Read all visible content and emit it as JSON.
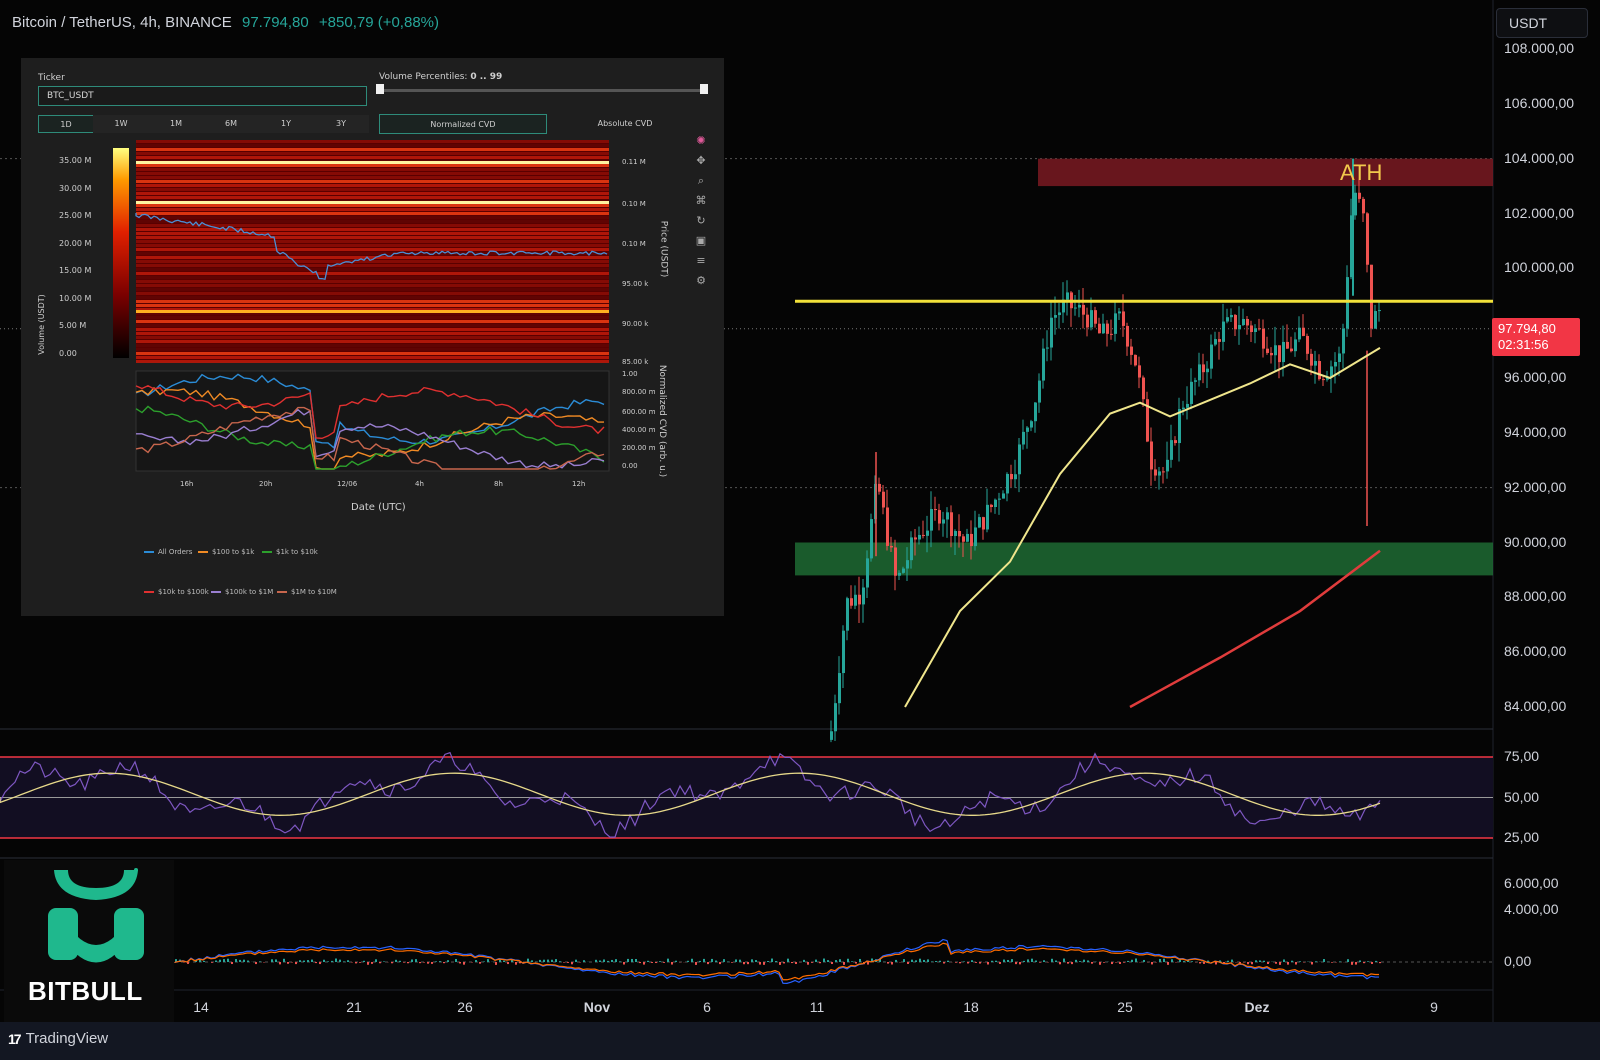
{
  "header": {
    "symbol": "Bitcoin / TetherUS, 4h, BINANCE",
    "last_price": "97.794,80",
    "change": "+850,79 (+0,88%)"
  },
  "currency_button": "USDT",
  "price_axis": [
    "108.000,00",
    "106.000,00",
    "104.000,00",
    "102.000,00",
    "100.000,00",
    "96.000,00",
    "94.000,00",
    "92.000,00",
    "90.000,00",
    "88.000,00",
    "86.000,00",
    "84.000,00"
  ],
  "last_price_tag": {
    "price": "97.794,80",
    "countdown": "02:31:56"
  },
  "ath_label": "ATH",
  "rsi_axis": [
    "75,00",
    "50,00",
    "25,00"
  ],
  "macd_axis": [
    "6.000,00",
    "4.000,00",
    "0,00"
  ],
  "date_axis": [
    {
      "label": "14",
      "bold": false
    },
    {
      "label": "21",
      "bold": false
    },
    {
      "label": "26",
      "bold": false
    },
    {
      "label": "Nov",
      "bold": true
    },
    {
      "label": "6",
      "bold": false
    },
    {
      "label": "11",
      "bold": false
    },
    {
      "label": "18",
      "bold": false
    },
    {
      "label": "25",
      "bold": false
    },
    {
      "label": "Dez",
      "bold": true
    },
    {
      "label": "9",
      "bold": false
    }
  ],
  "footer": {
    "brand": "TradingView",
    "mark": "17"
  },
  "bitbull": {
    "name": "BITBULL",
    "brand_color": "#1fb88d"
  },
  "colors": {
    "up": "#26a69a",
    "down": "#ef5350",
    "ath_zone": "#7a1a22",
    "support_zone": "#1f6b34",
    "resistance_line": "#f2e13a",
    "ma_fast": "#f0e68c",
    "ma_slow": "#e03c3c",
    "rsi_line": "#7e57c2"
  },
  "cvd": {
    "ticker_label": "Ticker",
    "ticker_value": "BTC_USDT",
    "volume_percentiles_label": "Volume Percentiles:",
    "volume_percentiles_value": "0 .. 99",
    "ranges": [
      "1D",
      "1W",
      "1M",
      "6M",
      "1Y",
      "3Y"
    ],
    "active_range": "1D",
    "modes": [
      "Normalized CVD",
      "Absolute CVD"
    ],
    "active_mode": "Normalized CVD",
    "volume_axis_title": "Volume (USDT)",
    "volume_ticks": [
      "35.00 M",
      "30.00 M",
      "25.00 M",
      "20.00 M",
      "15.00 M",
      "10.00 M",
      "5.00 M",
      "0.00"
    ],
    "price_axis_title": "Price (USDT)",
    "price_ticks": [
      "0.11 M",
      "0.10 M",
      "0.10 M",
      "95.00 k",
      "90.00 k",
      "85.00 k"
    ],
    "cvd_axis_title": "Normalized CVD (arb. u.)",
    "cvd_ticks": [
      "1.00",
      "800.00 m",
      "600.00 m",
      "400.00 m",
      "200.00 m",
      "0.00"
    ],
    "x_ticks": [
      "16h",
      "20h",
      "12/06",
      "4h",
      "8h",
      "12h"
    ],
    "x_title": "Date (UTC)",
    "legend": [
      {
        "label": "All Orders",
        "color": "#2b8cd6"
      },
      {
        "label": "$100 to $1k",
        "color": "#f08a24"
      },
      {
        "label": "$1k to $10k",
        "color": "#2ca02c"
      },
      {
        "label": "$10k to $100k",
        "color": "#e03030"
      },
      {
        "label": "$100k to $1M",
        "color": "#9a7fd1"
      },
      {
        "label": "$1M to $10M",
        "color": "#c8664d"
      }
    ]
  }
}
